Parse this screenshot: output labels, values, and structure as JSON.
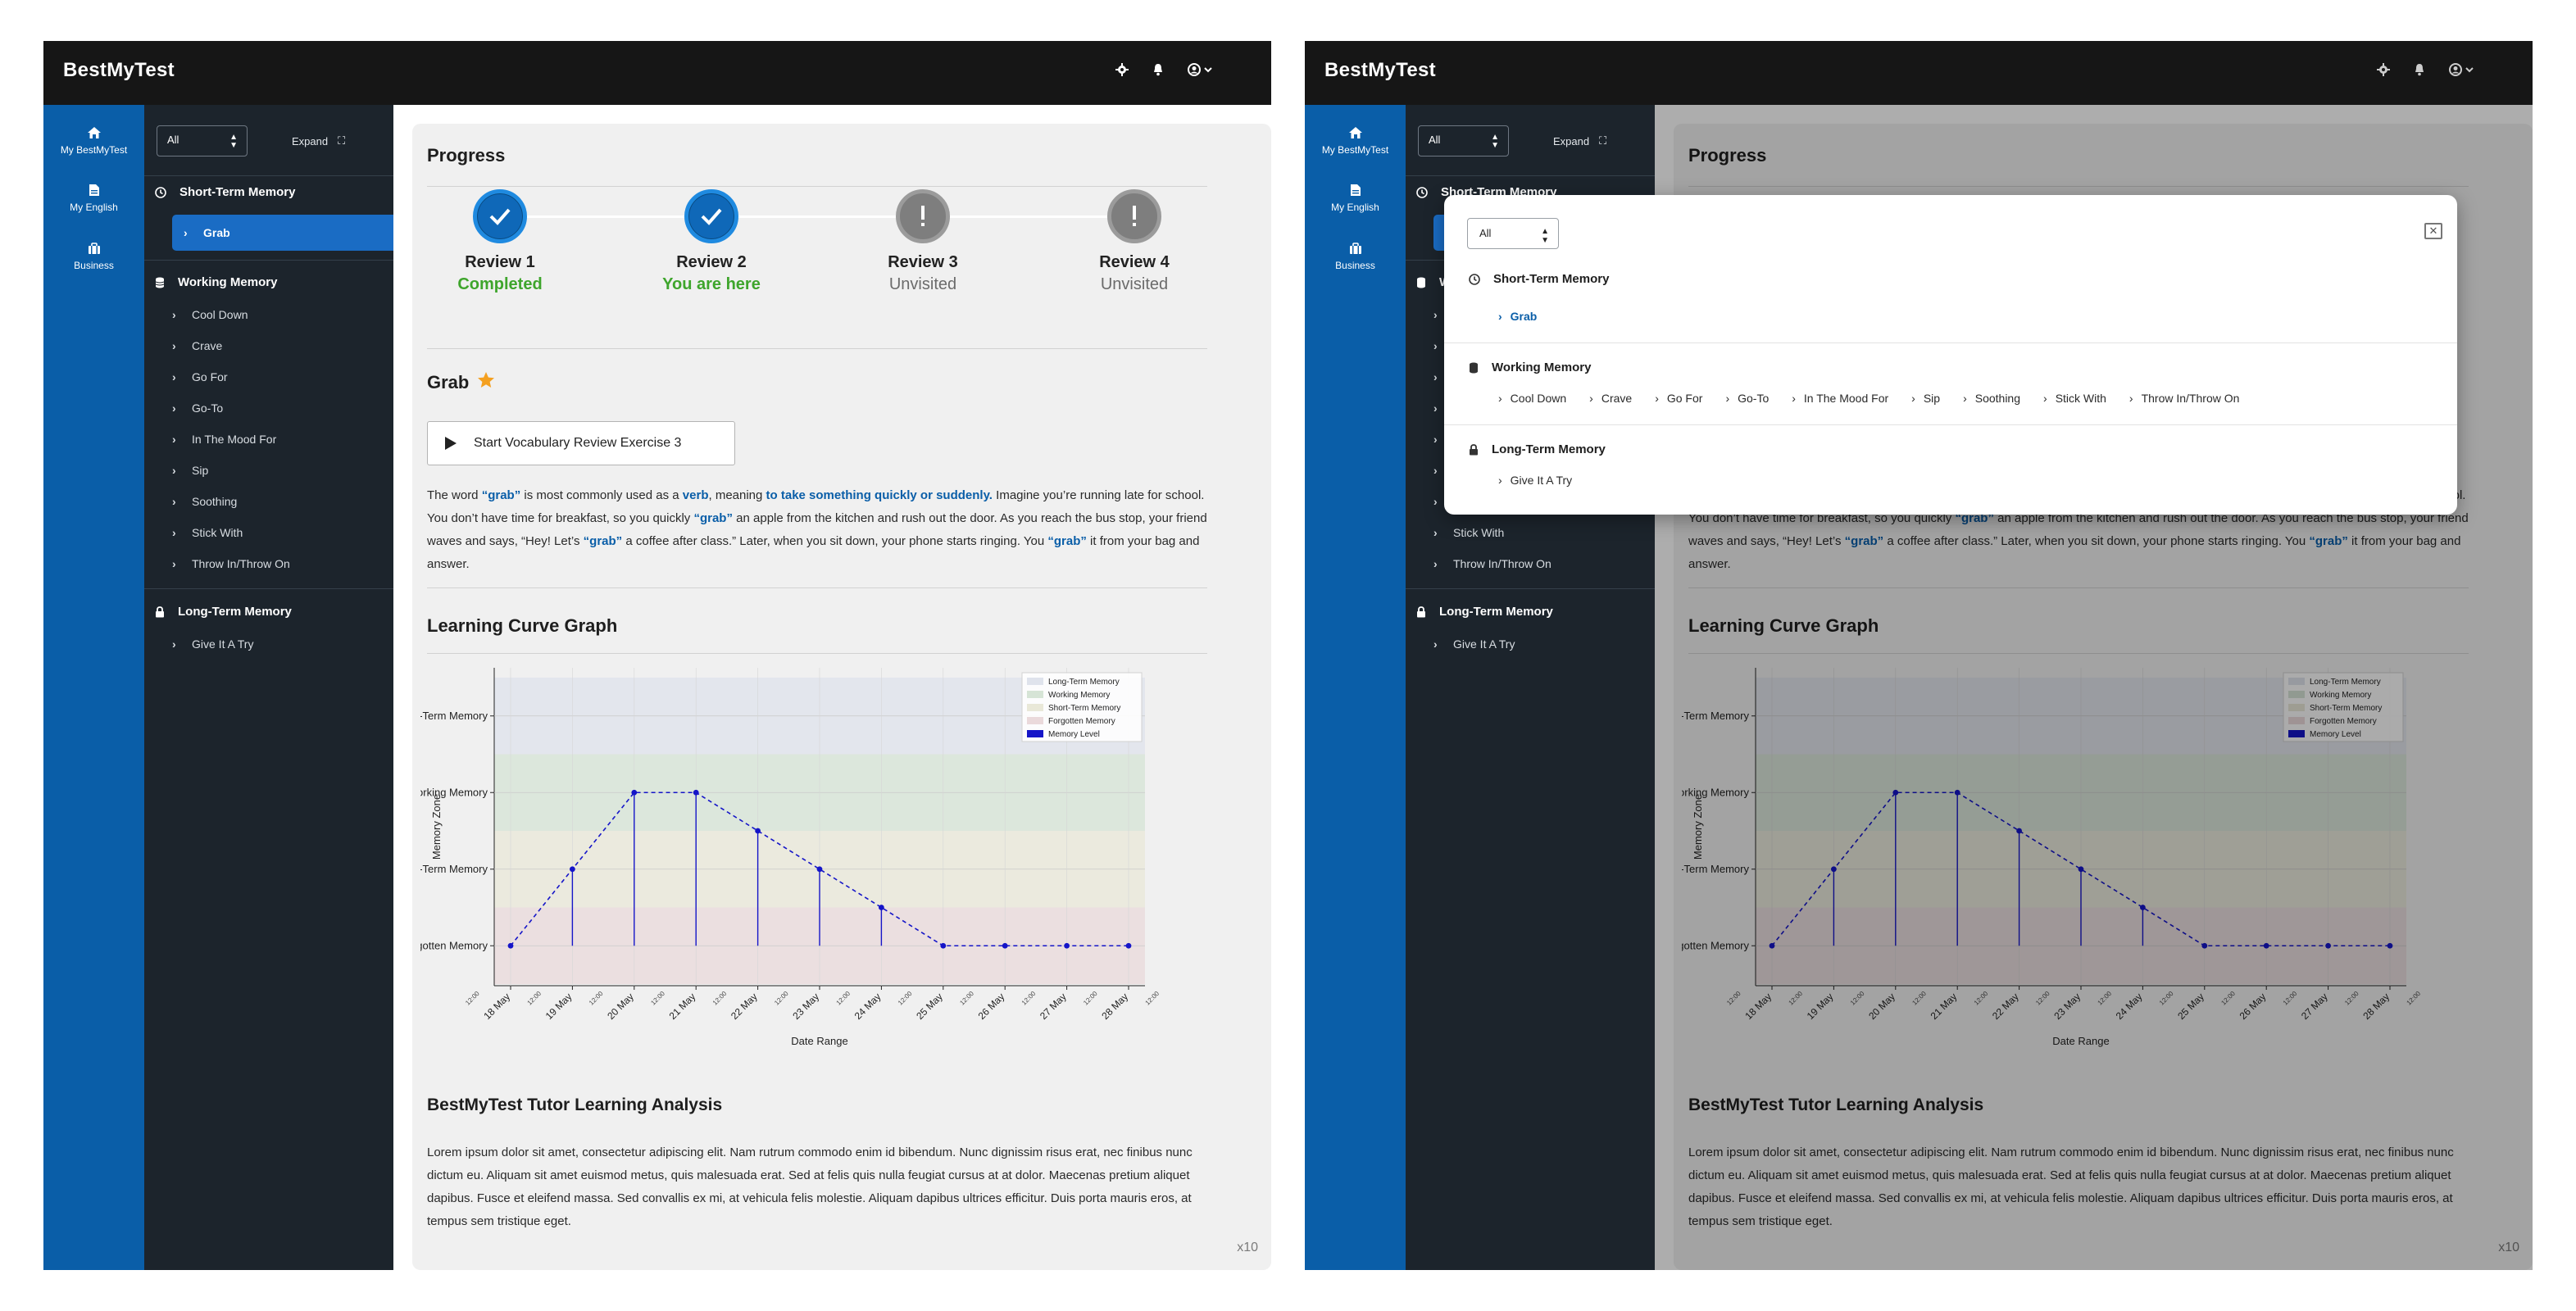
{
  "app": {
    "brand": "BestMyTest"
  },
  "nav": {
    "items": [
      {
        "label": "My BestMyTest",
        "icon": "home-icon"
      },
      {
        "label": "My English",
        "icon": "document-icon"
      },
      {
        "label": "Business",
        "icon": "briefcase-icon"
      }
    ]
  },
  "sidebar": {
    "filter_value": "All",
    "expand_label": "Expand",
    "sections": [
      {
        "title": "Short-Term Memory",
        "icon": "clock-icon",
        "items": [
          "Grab"
        ]
      },
      {
        "title": "Working Memory",
        "icon": "database-icon",
        "items": [
          "Cool Down",
          "Crave",
          "Go For",
          "Go-To",
          "In The Mood For",
          "Sip",
          "Soothing",
          "Stick With",
          "Throw In/Throw On"
        ]
      },
      {
        "title": "Long-Term Memory",
        "icon": "lock-icon",
        "items": [
          "Give It A Try"
        ]
      }
    ],
    "active_item": "Grab"
  },
  "progress": {
    "title": "Progress",
    "steps": [
      {
        "title": "Review 1",
        "status": "Completed",
        "state": "done"
      },
      {
        "title": "Review 2",
        "status": "You are here",
        "state": "done"
      },
      {
        "title": "Review 3",
        "status": "Unvisited",
        "state": "todo"
      },
      {
        "title": "Review 4",
        "status": "Unvisited",
        "state": "todo"
      }
    ]
  },
  "word": {
    "title": "Grab",
    "start_button": "Start Vocabulary Review Exercise 3",
    "description": {
      "p1": "The word ",
      "grab1": "“grab”",
      "p2": " is most commonly used as a ",
      "verb": "verb",
      "p3": ", meaning ",
      "meaning": "to take something quickly or suddenly.",
      "p4": " Imagine you’re running late for school. You don’t have time for breakfast, so you quickly ",
      "grab2": "“grab”",
      "p5": " an apple from the kitchen and rush out the door. As you reach the bus stop, your friend waves and says, “Hey! Let’s ",
      "grab3": "“grab”",
      "p6": " a coffee after class.” Later, when you sit down, your phone starts ringing. You ",
      "grab4": "“grab”",
      "p7": " it from your bag and answer."
    }
  },
  "graph": {
    "title": "Learning Curve Graph"
  },
  "chart_data": {
    "type": "line",
    "title": "",
    "xlabel": "Date Range",
    "ylabel": "Memory Zone",
    "x": [
      "18 May",
      "19 May",
      "20 May",
      "21 May",
      "22 May",
      "23 May",
      "24 May",
      "25 May",
      "26 May",
      "27 May",
      "28 May"
    ],
    "x_minor_ticks": "12:00",
    "y_categories": [
      "Forgotten Memory",
      "Short-Term Memory",
      "Working Memory",
      "Long-Term Memory"
    ],
    "series": [
      {
        "name": "Memory Level",
        "values": [
          0,
          1,
          2,
          2,
          1.5,
          1,
          0.5,
          0,
          0,
          0,
          0
        ]
      }
    ],
    "bands": [
      {
        "name": "Long-Term Memory",
        "color": "#dfe3ec"
      },
      {
        "name": "Working Memory",
        "color": "#d6e4d6"
      },
      {
        "name": "Short-Term Memory",
        "color": "#e9e8d8"
      },
      {
        "name": "Forgotten Memory",
        "color": "#ead9db"
      }
    ],
    "line_color": "#1515c8",
    "legend": "top-right",
    "grid": true
  },
  "analysis": {
    "title": "BestMyTest Tutor Learning Analysis",
    "text": "Lorem ipsum dolor sit amet, consectetur adipiscing elit. Nam rutrum commodo enim id bibendum. Nunc dignissim risus erat, nec finibus nunc dictum eu. Aliquam sit amet euismod metus, quis malesuada erat. Sed at felis quis nulla feugiat cursus at at dolor. Maecenas pretium aliquet dapibus. Fusce et eleifend massa. Sed convallis ex mi, at vehicula felis molestie. Aliquam dapibus ultrices efficitur. Duis porta mauris eros, at tempus sem tristique eget.",
    "multiplier": "x10"
  },
  "modal": {
    "filter_value": "All",
    "close_label": "✕"
  },
  "colors": {
    "accent": "#0a5ea8",
    "topbar": "#161616",
    "sidebar": "#1c242c",
    "success": "#3ea52c"
  }
}
